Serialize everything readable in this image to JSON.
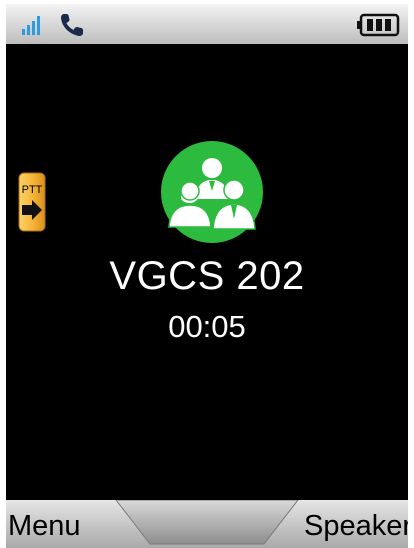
{
  "status_bar": {
    "icons": [
      "signal-icon",
      "phone-icon",
      "battery-icon"
    ],
    "signal_color": "#2c9be0",
    "phone_color": "#1a2a4a"
  },
  "ptt_indicator": {
    "label": "PTT",
    "icon": "arrow-right-icon",
    "color": "#f6b63b"
  },
  "call": {
    "avatar_icon": "group-users-icon",
    "avatar_color": "#2dbb3f",
    "name": "VGCS 202",
    "timer": "00:05"
  },
  "softkeys": {
    "left": "Menu",
    "right": "Speaker"
  }
}
